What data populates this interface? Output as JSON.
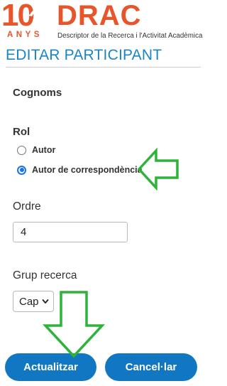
{
  "header": {
    "logo_number": "10",
    "logo_anys": "ANYS",
    "logo_drac": "DRAC",
    "logo_subtitle": "Descriptor de la Recerca i l'Activitat Acadèmica"
  },
  "page": {
    "title": "EDITAR PARTICIPANT"
  },
  "form": {
    "cognoms_label": "Cognoms",
    "rol_label": "Rol",
    "rol_options": [
      {
        "label": "Autor",
        "checked": false
      },
      {
        "label": "Autor de correspondència",
        "checked": true
      }
    ],
    "ordre_label": "Ordre",
    "ordre_value": "4",
    "grup_label": "Grup recerca",
    "grup_selected": "Cap"
  },
  "actions": {
    "update_label": "Actualitzar",
    "cancel_label": "Cancel·lar"
  },
  "colors": {
    "brand": "#e8552b",
    "title": "#1a84c6",
    "button": "#1277c2",
    "annotation": "#2db33a"
  }
}
